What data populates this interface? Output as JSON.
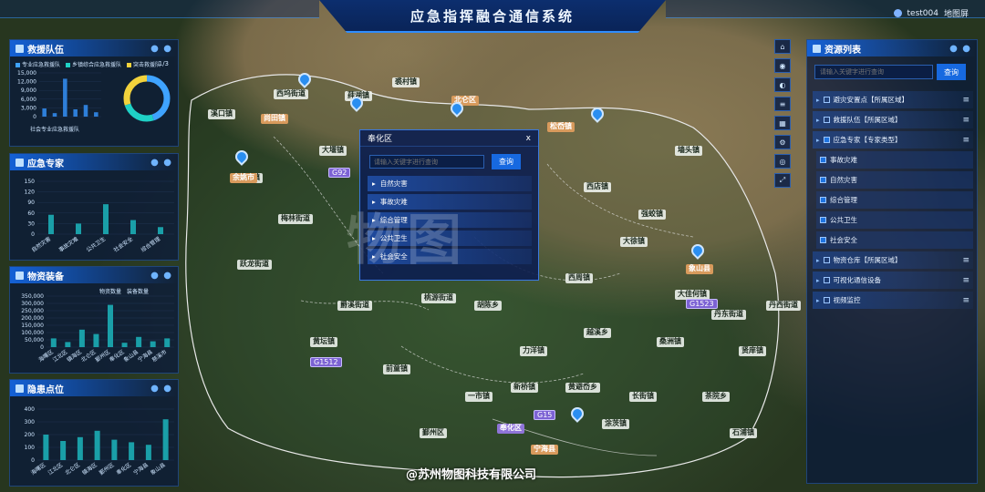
{
  "header": {
    "title": "应急指挥融合通信系统",
    "user": "test004",
    "menu": "地图屏"
  },
  "rescue_team": {
    "title": "救援队伍",
    "legend": [
      "专业应急救援队",
      "乡镇综合应急救援队",
      "突击救援队"
    ],
    "legend_colors": [
      "#3fa3ff",
      "#1fd1c6",
      "#f2d23c"
    ],
    "pager": "1/3",
    "yticks": [
      "15,000",
      "12,000",
      "9,000",
      "6,000",
      "3,000",
      "0"
    ],
    "category_label": "社会专业应急救援队",
    "bar_values": [
      2800,
      1200,
      13000,
      2500,
      4000,
      1500
    ],
    "donut": [
      0.45,
      0.25,
      0.3
    ]
  },
  "experts": {
    "title": "应急专家",
    "yticks": [
      "150",
      "120",
      "90",
      "60",
      "30",
      "0"
    ],
    "categories": [
      "自然灾害",
      "事故灾难",
      "公共卫生",
      "社会安全",
      "综合管理"
    ],
    "values": [
      55,
      30,
      85,
      40,
      20
    ]
  },
  "supplies": {
    "title": "物资装备",
    "legend": [
      "物资数量",
      "装备数量"
    ],
    "yticks": [
      "350,000",
      "300,000",
      "250,000",
      "200,000",
      "150,000",
      "100,000",
      "50,000",
      "0"
    ],
    "categories": [
      "海曙区",
      "江北区",
      "镇海区",
      "北仑区",
      "鄞州区",
      "奉化区",
      "象山县",
      "宁海县",
      "慈溪市"
    ],
    "values": [
      60000,
      35000,
      120000,
      90000,
      290000,
      30000,
      70000,
      40000,
      60000
    ]
  },
  "hazard": {
    "title": "隐患点位",
    "yticks": [
      "400",
      "300",
      "200",
      "100",
      "0"
    ],
    "categories": [
      "海曙区",
      "江北区",
      "北仑区",
      "镇海区",
      "鄞州区",
      "奉化区",
      "宁海县",
      "象山县"
    ],
    "values": [
      200,
      150,
      180,
      230,
      160,
      140,
      120,
      320
    ]
  },
  "resources": {
    "title": "资源列表",
    "search_placeholder": "请输入关键字进行查询",
    "search_button": "查询",
    "items": [
      {
        "label": "避灾安置点【所属区域】",
        "level": "top",
        "checked": false
      },
      {
        "label": "救援队伍【所属区域】",
        "level": "top",
        "checked": false
      },
      {
        "label": "应急专家【专家类型】",
        "level": "top",
        "checked": true
      },
      {
        "label": "事故灾难",
        "level": "child",
        "checked": true
      },
      {
        "label": "自然灾害",
        "level": "child",
        "checked": true
      },
      {
        "label": "综合管理",
        "level": "child",
        "checked": true
      },
      {
        "label": "公共卫生",
        "level": "child",
        "checked": true
      },
      {
        "label": "社会安全",
        "level": "child",
        "checked": true
      },
      {
        "label": "物资仓库【所属区域】",
        "level": "top",
        "checked": false
      },
      {
        "label": "可视化通信设备",
        "level": "top",
        "checked": false
      },
      {
        "label": "视频监控",
        "level": "top",
        "checked": false
      }
    ]
  },
  "popup": {
    "title": "奉化区",
    "close": "x",
    "search_placeholder": "请输入关键字进行查询",
    "search_button": "查询",
    "items": [
      "自然灾害",
      "事故灾难",
      "综合管理",
      "公共卫生",
      "社会安全"
    ]
  },
  "map": {
    "places": [
      "奉化区",
      "溪口镇",
      "西坞街道",
      "大堰镇",
      "尚田镇",
      "莼湖镇",
      "裘村镇",
      "松岙镇",
      "西店镇",
      "强蛟镇",
      "大佳何镇",
      "深甽镇",
      "梅林街道",
      "跃龙街道",
      "桃源街道",
      "胡陈乡",
      "力洋镇",
      "长街镇",
      "茶院乡",
      "越溪乡",
      "一市镇",
      "前童镇",
      "黄坛镇",
      "桑洲镇",
      "象山县",
      "宁海县",
      "余姚市",
      "北仑区",
      "鄞州区",
      "石浦镇",
      "贤庠镇",
      "墙头镇",
      "大徐镇",
      "西周镇",
      "丹西街道",
      "丹东街道",
      "爵溪街道",
      "新桥镇",
      "涂茨镇",
      "黄避岙乡"
    ],
    "roads": [
      "G1512",
      "G15",
      "G92",
      "G1523"
    ]
  },
  "watermark": "物图",
  "bottom_watermark": "@苏州物图科技有限公司"
}
